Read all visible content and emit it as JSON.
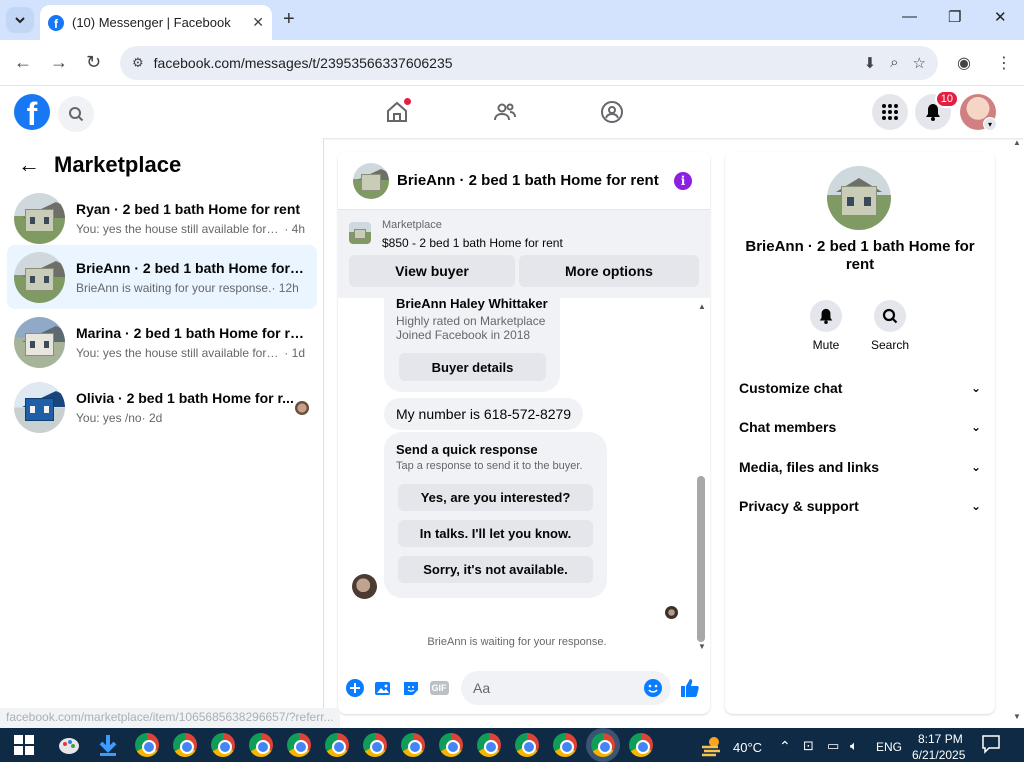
{
  "browser": {
    "tab_title": "(10) Messenger | Facebook",
    "url": "facebook.com/messages/t/23953566337606235",
    "status_url": "facebook.com/marketplace/item/1065685638296657/?referr..."
  },
  "header": {
    "notification_count": "10"
  },
  "sidebar": {
    "title": "Marketplace",
    "conversations": [
      {
        "title": "Ryan · 2 bed 1 bath Home for rent",
        "message": "You: yes the house still available for re...",
        "time": "· 4h"
      },
      {
        "title": "BrieAnn · 2 bed 1 bath Home for r...",
        "message": "BrieAnn is waiting for your response.",
        "time": "· 12h"
      },
      {
        "title": "Marina · 2 bed 1 bath Home for rent",
        "message": "You: yes the house still available for re...",
        "time": "· 1d"
      },
      {
        "title": "Olivia · 2 bed 1 bath Home for r...",
        "message": "You: yes /no",
        "time": "· 2d"
      }
    ]
  },
  "chat": {
    "title": "BrieAnn · 2 bed 1 bath Home for rent",
    "listing_label": "Marketplace",
    "listing_price": "$850 - 2 bed 1 bath Home for rent",
    "view_buyer": "View buyer",
    "more_options": "More options",
    "buyer_name": "BrieAnn Haley Whittaker",
    "buyer_rating": "Highly rated on Marketplace",
    "buyer_joined": "Joined Facebook in 2018",
    "buyer_details": "Buyer details",
    "message_number": "My number is 618-572-8279",
    "quick_title": "Send a quick response",
    "quick_sub": "Tap a response to send it to the buyer.",
    "quick_replies": [
      "Yes, are you interested?",
      "In talks. I'll let you know.",
      "Sorry, it's not available."
    ],
    "waiting_status": "BrieAnn is waiting for your response.",
    "input_placeholder": "Aa",
    "gif_label": "GIF"
  },
  "info_panel": {
    "name": "BrieAnn · 2 bed 1 bath Home for rent",
    "mute": "Mute",
    "search": "Search",
    "sections": [
      "Customize chat",
      "Chat members",
      "Media, files and links",
      "Privacy & support"
    ]
  },
  "taskbar": {
    "temperature": "40°C",
    "language": "ENG",
    "time": "8:17 PM",
    "date": "6/21/2025"
  },
  "colors": {
    "facebook_blue": "#1877f2",
    "messenger_blue": "#0a7cff",
    "info_purple": "#8d1fe0",
    "notification_red": "#e41e3f"
  }
}
